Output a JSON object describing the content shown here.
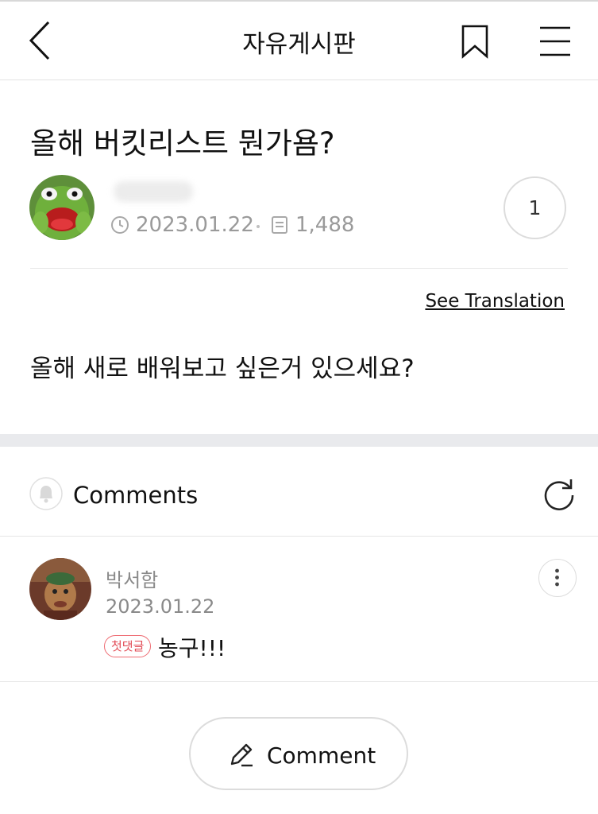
{
  "header": {
    "title": "자유게시판",
    "back_icon": "chevron-left-icon",
    "bookmark_icon": "bookmark-icon",
    "menu_icon": "hamburger-menu-icon"
  },
  "post": {
    "title": "올해 버킷리스트 뭔가욤?",
    "author": "",
    "date": "2023.01.22",
    "views": "1,488",
    "comment_count": "1",
    "see_translation": "See Translation",
    "body": "올해 새로 배워보고 싶은거 있으세요?"
  },
  "comments": {
    "label": "Comments",
    "items": [
      {
        "author": "박서함",
        "date": "2023.01.22",
        "badge": "첫댓글",
        "text": "농구!!!"
      }
    ]
  },
  "write_button": {
    "label": "Comment"
  },
  "colors": {
    "badge": "#e24b55",
    "divider": "#e6e6e6",
    "section_gap": "#e9eaed"
  }
}
